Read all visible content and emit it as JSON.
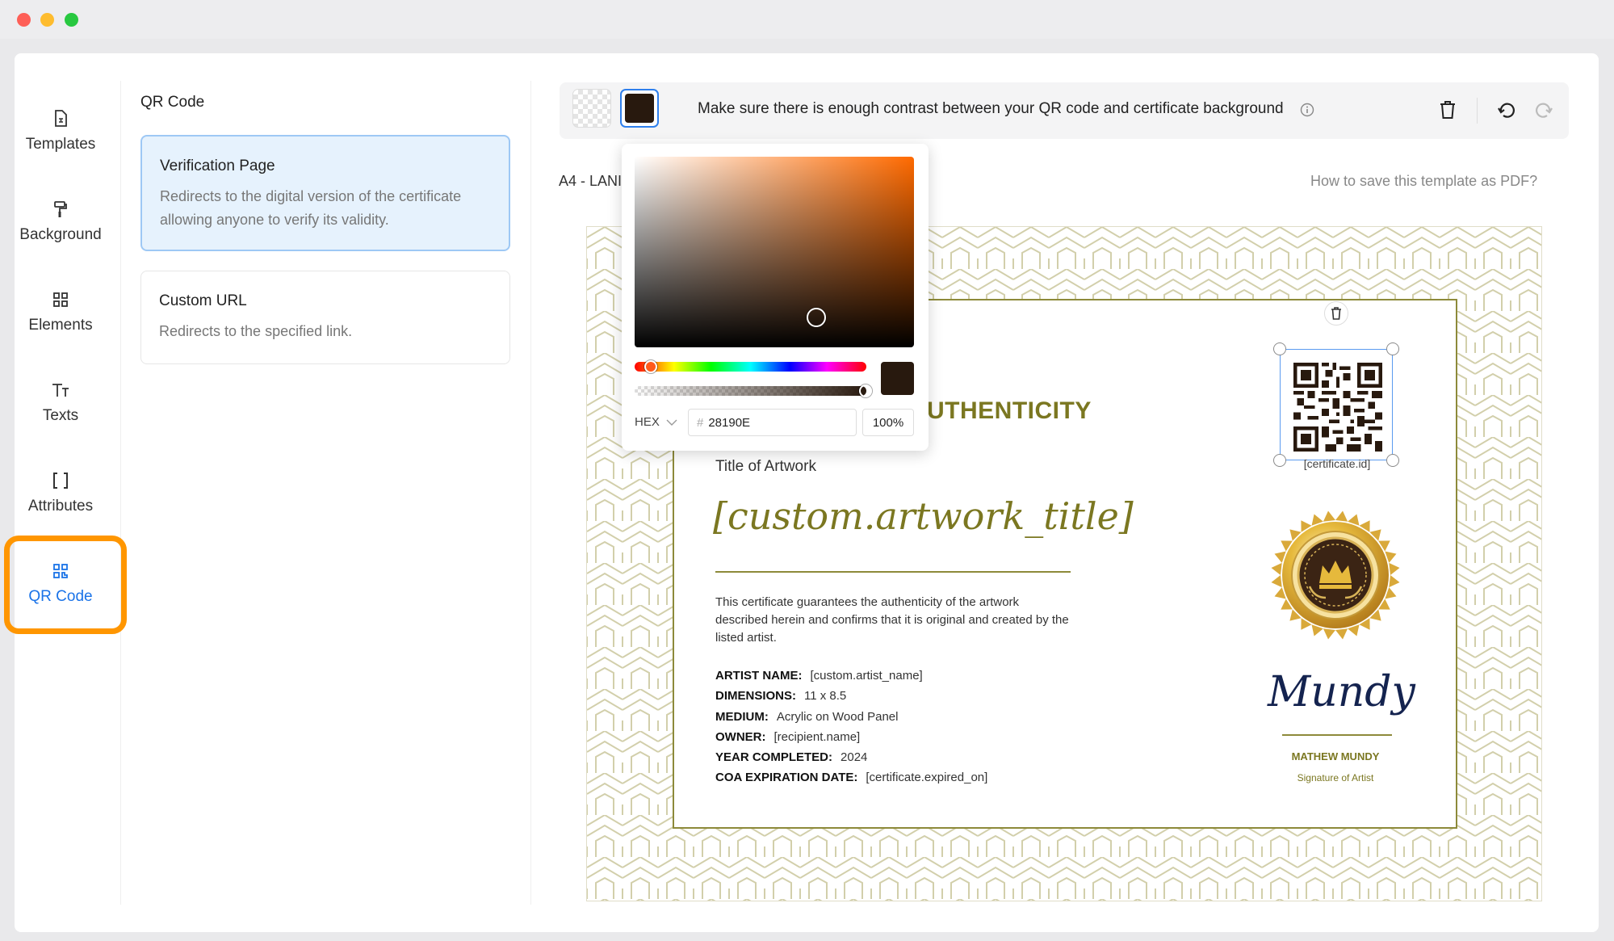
{
  "sidebar": {
    "items": [
      {
        "label": "Templates",
        "icon": "template-icon"
      },
      {
        "label": "Background",
        "icon": "paint-roller-icon"
      },
      {
        "label": "Elements",
        "icon": "elements-grid-icon"
      },
      {
        "label": "Texts",
        "icon": "text-icon"
      },
      {
        "label": "Attributes",
        "icon": "brackets-icon"
      },
      {
        "label": "QR Code",
        "icon": "qr-code-icon",
        "active": true
      }
    ],
    "highlight_color": "#ff9600"
  },
  "panel": {
    "title": "QR Code",
    "options": [
      {
        "title": "Verification Page",
        "description": "Redirects to the digital version of the certificate allowing anyone to verify its validity.",
        "selected": true
      },
      {
        "title": "Custom URL",
        "description": "Redirects to the specified link.",
        "selected": false
      }
    ]
  },
  "toolbar": {
    "message": "Make sure there is enough contrast between your QR code and certificate background",
    "selected_color": "#28190E",
    "icons": [
      "info-icon",
      "trash-icon",
      "undo-icon",
      "redo-icon"
    ]
  },
  "canvas": {
    "size_label": "A4 - LANI",
    "help_link": "How to save this template as PDF?"
  },
  "color_picker": {
    "format": "HEX",
    "hex_value": "28190E",
    "opacity": "100%",
    "hue_color": "#ff6a00"
  },
  "certificate": {
    "heading": "UTHENTICITY",
    "artwork_label": "Title of Artwork",
    "artwork_title": "[custom.artwork_title]",
    "description": "This certificate guarantees the authenticity of the artwork described herein and confirms that it is original and created by the listed artist.",
    "fields": [
      {
        "label": "ARTIST NAME:",
        "value": "[custom.artist_name]"
      },
      {
        "label": "DIMENSIONS:",
        "value": "11 x 8.5"
      },
      {
        "label": "MEDIUM:",
        "value": "Acrylic on Wood Panel"
      },
      {
        "label": "OWNER:",
        "value": "[recipient.name]"
      },
      {
        "label": "YEAR COMPLETED:",
        "value": "2024"
      },
      {
        "label": "COA EXPIRATION DATE:",
        "value": "[certificate.expired_on]"
      }
    ],
    "qr_caption": "[certificate.id]",
    "signature": "Mundy",
    "signer_name": "MATHEW MUNDY",
    "signer_role": "Signature of Artist",
    "accent_color": "#7b7721"
  }
}
